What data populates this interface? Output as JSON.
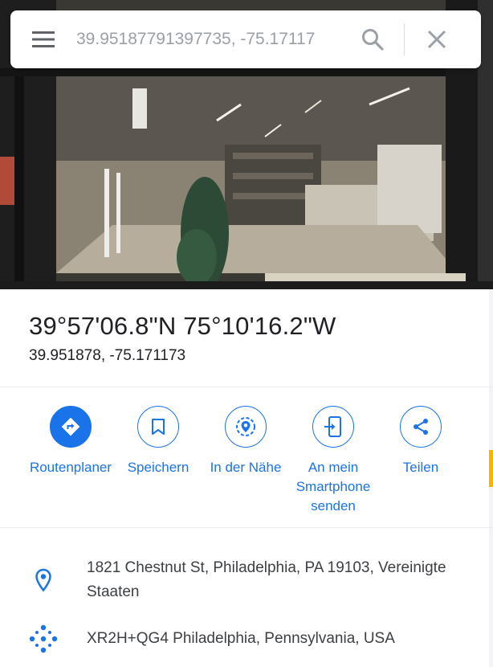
{
  "search": {
    "value": "39.95187791397735, -75.17117",
    "menu_icon": "hamburger-menu-icon",
    "search_icon": "search-icon",
    "close_icon": "close-icon"
  },
  "place": {
    "dms": "39°57'06.8\"N 75°10'16.2\"W",
    "decimal": "39.951878, -75.171173"
  },
  "actions": [
    {
      "label": "Routenplaner",
      "icon": "directions-icon",
      "filled": true
    },
    {
      "label": "Speichern",
      "icon": "bookmark-icon",
      "filled": false
    },
    {
      "label": "In der Nähe",
      "icon": "nearby-icon",
      "filled": false
    },
    {
      "label": "An mein Smartphone senden",
      "icon": "send-to-phone-icon",
      "filled": false
    },
    {
      "label": "Teilen",
      "icon": "share-icon",
      "filled": false
    }
  ],
  "info": {
    "address": "1821 Chestnut St, Philadelphia, PA 19103, Vereinigte Staaten",
    "plus_code": "XR2H+QG4 Philadelphia, Pennsylvania, USA"
  },
  "colors": {
    "accent": "#1a73e8",
    "text": "#202124",
    "secondary_text": "#3c4043",
    "divider": "#e8eaed"
  }
}
